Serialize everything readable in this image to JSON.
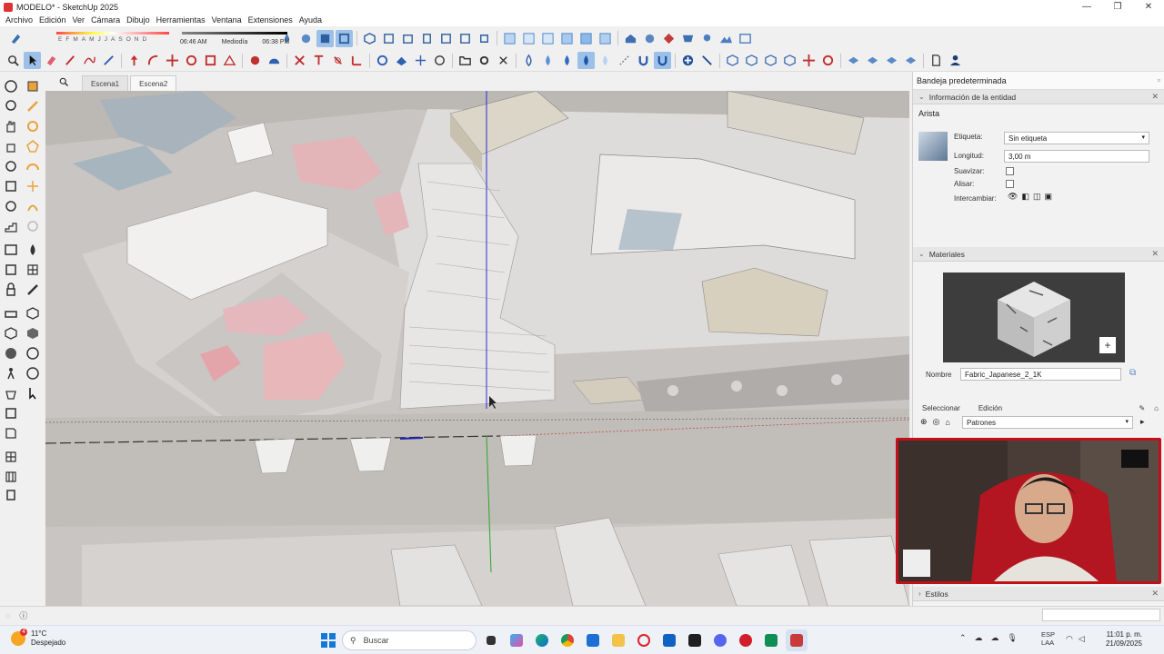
{
  "window": {
    "title": "MODELO* - SketchUp 2025"
  },
  "menu": [
    "Archivo",
    "Edición",
    "Ver",
    "Cámara",
    "Dibujo",
    "Herramientas",
    "Ventana",
    "Extensiones",
    "Ayuda"
  ],
  "shadows": {
    "months": [
      "E",
      "F",
      "M",
      "A",
      "M",
      "J",
      "J",
      "A",
      "S",
      "O",
      "N",
      "D"
    ],
    "time_start": "06:46 AM",
    "time_mid": "Mediodía",
    "time_end": "06:38 PM"
  },
  "scenes": [
    "Escena1",
    "Escena2"
  ],
  "tray": {
    "title": "Bandeja predeterminada",
    "entity_panel": {
      "header": "Información de la entidad",
      "entity_type": "Arista",
      "label_label": "Etiqueta:",
      "label_value": "Sin etiqueta",
      "length_label": "Longitud:",
      "length_value": "3,00 m",
      "soften_label": "Suavizar:",
      "smooth_label": "Alisar:",
      "toggle_label": "Intercambiar:"
    },
    "materials_panel": {
      "header": "Materiales",
      "name_label": "Nombre",
      "name_value": "Fabric_Japanese_2_1K",
      "tab_select": "Seleccionar",
      "tab_edit": "Edición",
      "collection": "Patrones"
    },
    "styles_panel": {
      "header": "Estilos"
    }
  },
  "taskbar": {
    "weather_temp": "11°C",
    "weather_desc": "Despejado",
    "weather_badge": "4",
    "search_placeholder": "Buscar",
    "lang_top": "ESP",
    "lang_bottom": "LAA",
    "time": "11:01 p. m.",
    "date": "21/09/2025"
  }
}
